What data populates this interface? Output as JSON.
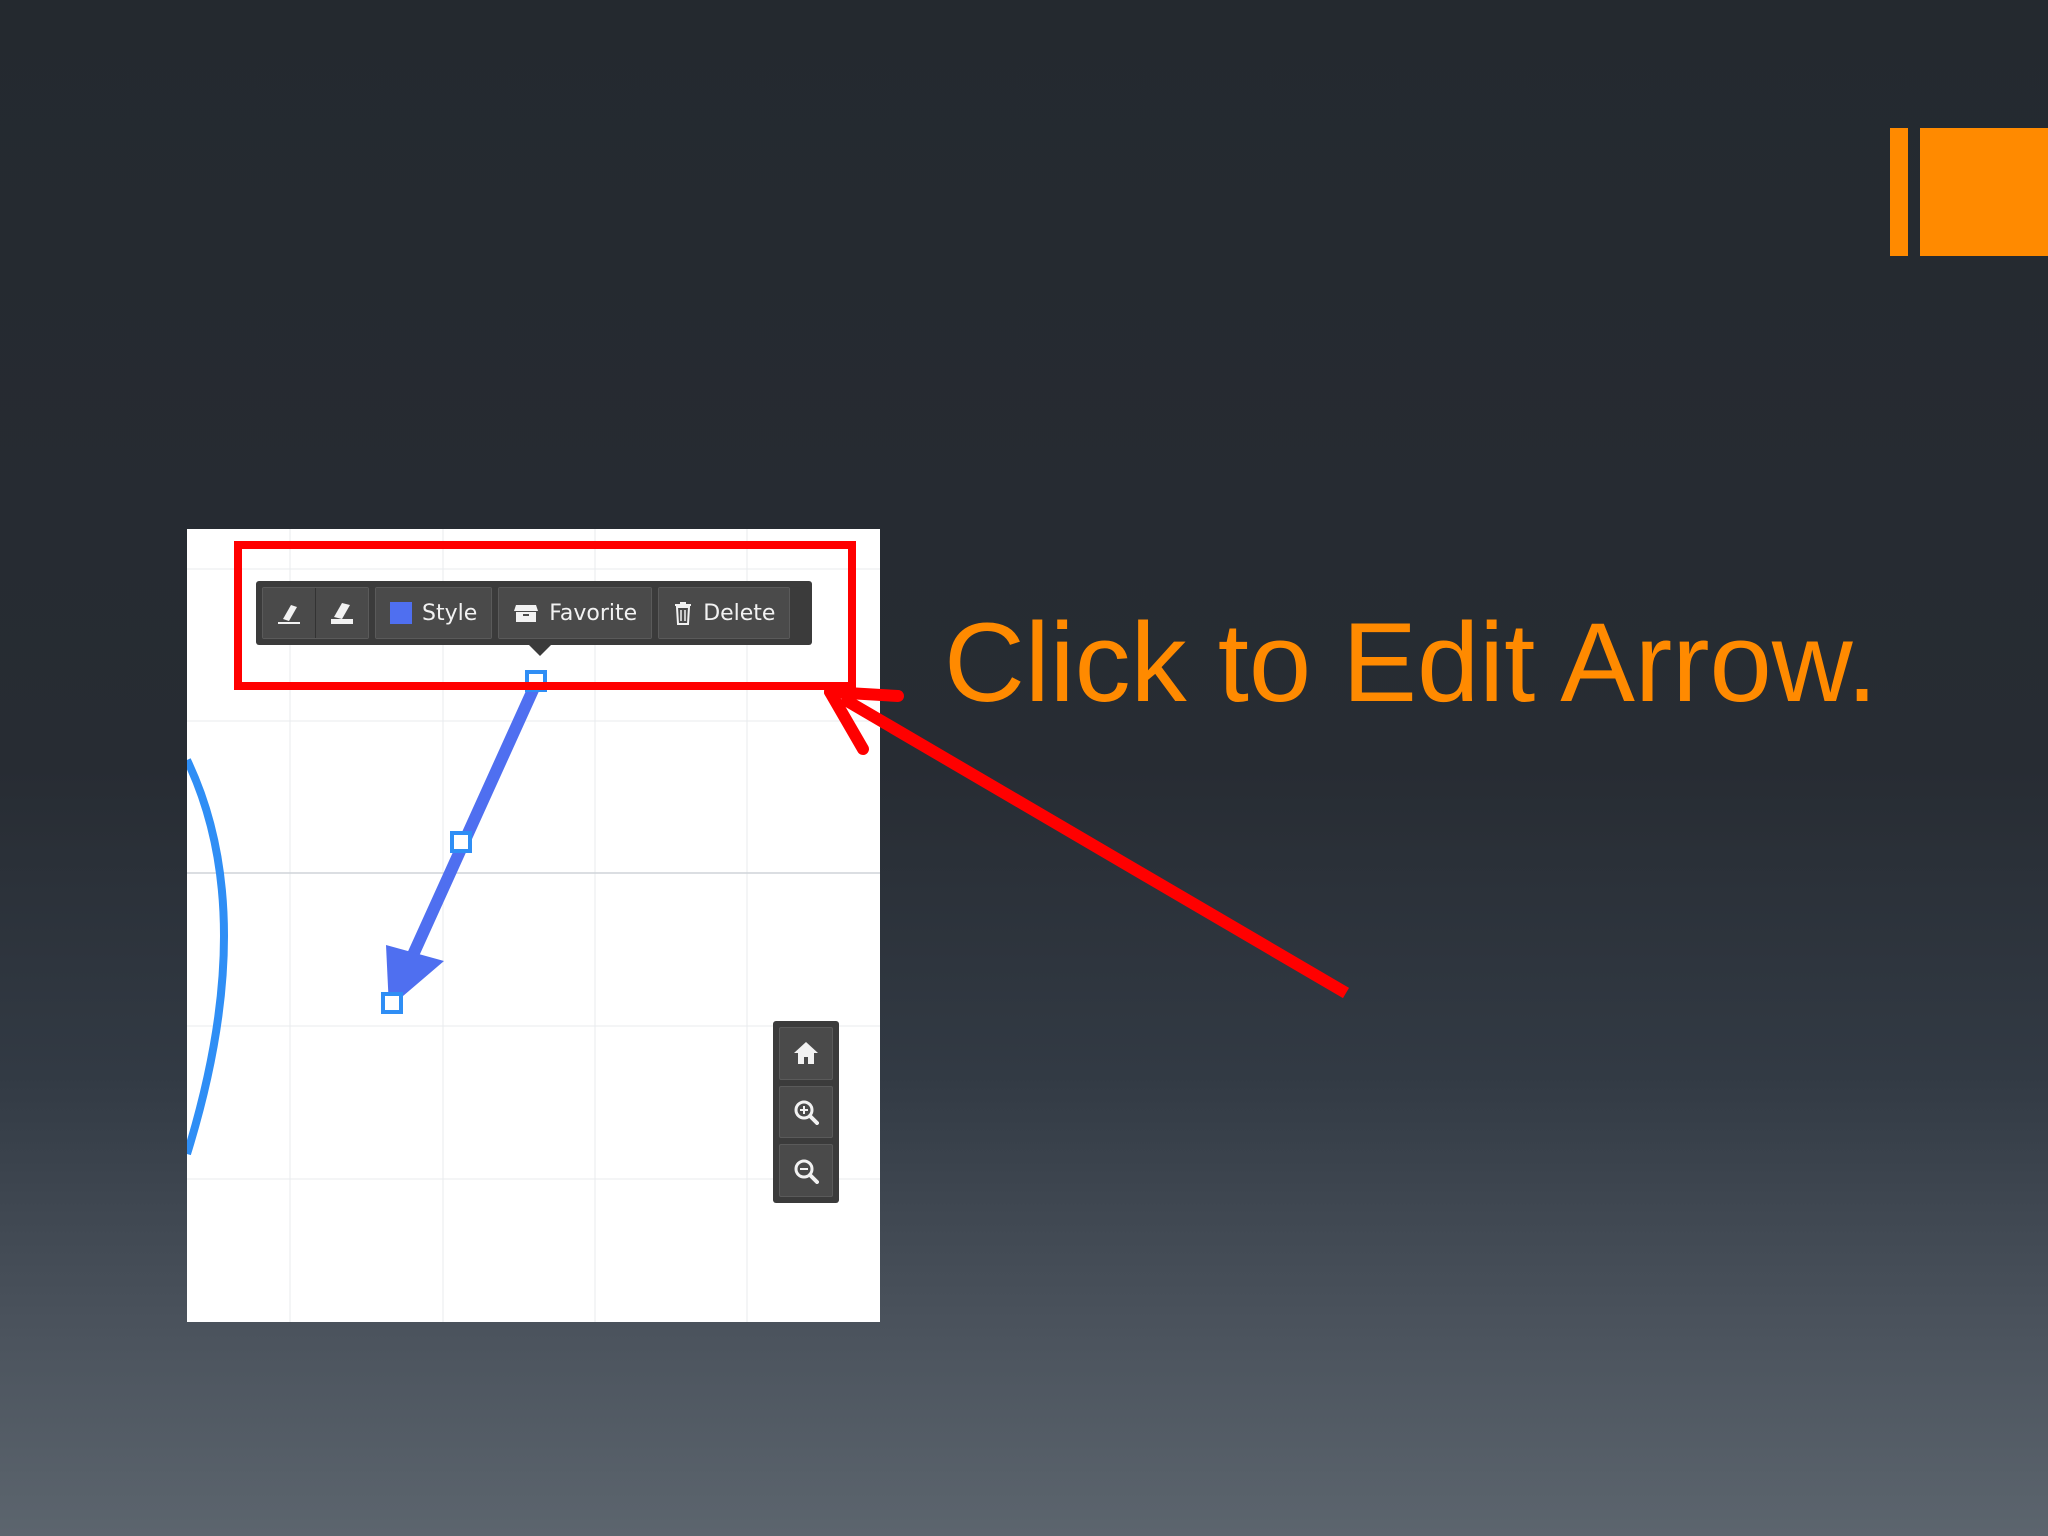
{
  "slide": {
    "headline": "Click to Edit Arrow.",
    "accent_color": "#ff8a00",
    "annotation_color": "#ff0000"
  },
  "toolbar": {
    "buttons": [
      {
        "icon": "eraser-icon",
        "label": ""
      },
      {
        "icon": "eraser-fill-icon",
        "label": ""
      },
      {
        "icon": "color-swatch",
        "label": "Style",
        "swatch_color": "#4f6ff0"
      },
      {
        "icon": "archive-icon",
        "label": "Favorite"
      },
      {
        "icon": "trash-icon",
        "label": "Delete"
      }
    ]
  },
  "zoom_controls": [
    {
      "icon": "home-icon"
    },
    {
      "icon": "zoom-in-icon"
    },
    {
      "icon": "zoom-out-icon"
    }
  ],
  "canvas": {
    "arrow_color": "#4f6ff0",
    "circle_color": "#2f8ef5",
    "handle_color": "#2f8ef5"
  }
}
